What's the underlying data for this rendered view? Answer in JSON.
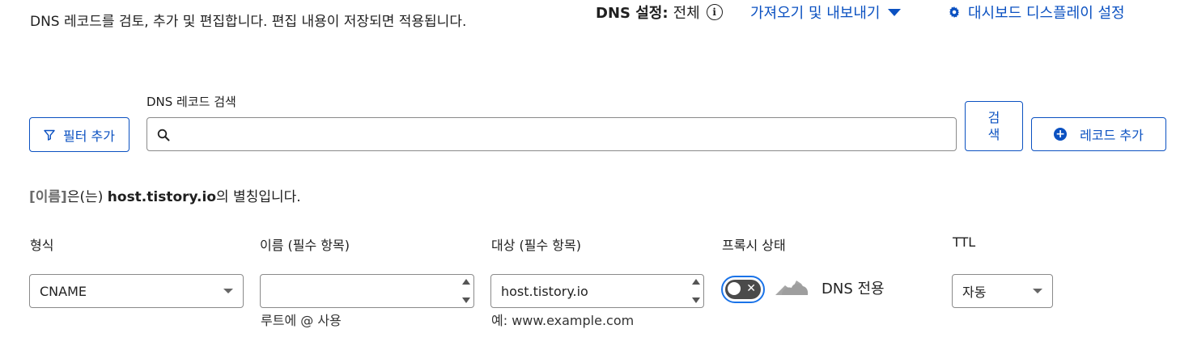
{
  "header": {
    "description": "DNS 레코드를 검토, 추가 및 편집합니다. 편집 내용이 저장되면 적용됩니다.",
    "dns_setting_label": "DNS 설정:",
    "dns_setting_value": "전체",
    "import_export": "가져오기 및 내보내기",
    "dashboard_settings": "대시보드 디스플레이 설정"
  },
  "toolbar": {
    "filter_button": "필터 추가",
    "search_label": "DNS 레코드 검색",
    "search_value": "",
    "search_button_line1": "검",
    "search_button_line2": "색",
    "add_record_button": "레코드 추가"
  },
  "alias_note": {
    "name_tag": "[이름]",
    "middle": "은(는) ",
    "host": "host.tistory.io",
    "tail": "의 별칭입니다."
  },
  "form": {
    "type": {
      "label": "형식",
      "value": "CNAME"
    },
    "name": {
      "label": "이름 (필수 항목)",
      "value": "",
      "helper": "루트에 @ 사용"
    },
    "target": {
      "label": "대상 (필수 항목)",
      "value": "host.tistory.io",
      "helper": "예: www.example.com"
    },
    "proxy": {
      "label": "프록시 상태",
      "toggle_on": false,
      "status_text": "DNS 전용"
    },
    "ttl": {
      "label": "TTL",
      "value": "자동"
    }
  },
  "colors": {
    "accent": "#0b51c1",
    "toggle_focus": "#1a73e8",
    "toggle_track": "#4a4a4a",
    "cloud_gray": "#9e9e9e"
  },
  "icons": {
    "info": "info-icon",
    "caret": "caret-down-icon",
    "gear": "gear-icon",
    "filter": "filter-icon",
    "search": "search-icon",
    "plus": "plus-circle-icon",
    "cloud": "cloud-icon"
  }
}
